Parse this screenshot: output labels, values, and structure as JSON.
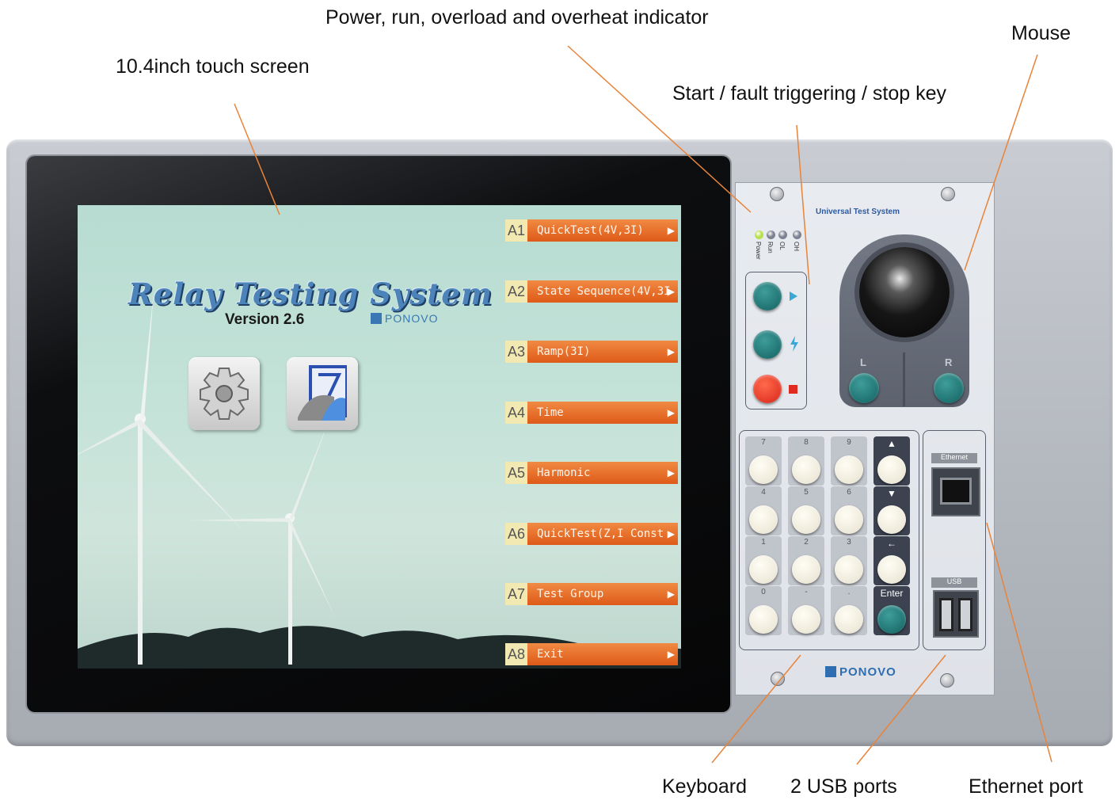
{
  "callouts": {
    "indicator": "Power, run, overload and overheat indicator",
    "mouse": "Mouse",
    "touch_screen": "10.4inch touch screen",
    "keys": "Start / fault triggering / stop key",
    "keyboard": "Keyboard",
    "usb": "2 USB ports",
    "ethernet": "Ethernet port"
  },
  "screen": {
    "title": "Relay Testing System",
    "version": "Version 2.6",
    "brand": "PONOVO",
    "icons": [
      "gear-icon",
      "document-icon"
    ],
    "menu": [
      {
        "code": "A1",
        "label": "QuickTest(4V,3I)"
      },
      {
        "code": "A2",
        "label": "State Sequence(4V,3I"
      },
      {
        "code": "A3",
        "label": "Ramp(3I)"
      },
      {
        "code": "A4",
        "label": "Time"
      },
      {
        "code": "A5",
        "label": "Harmonic"
      },
      {
        "code": "A6",
        "label": "QuickTest(Z,I Const"
      },
      {
        "code": "A7",
        "label": "Test Group"
      },
      {
        "code": "A8",
        "label": "Exit"
      }
    ]
  },
  "panel": {
    "title": "Universal Test System",
    "leds": [
      {
        "label": "Power",
        "color": "#b8e04a"
      },
      {
        "label": "Run",
        "color": "#7d8290"
      },
      {
        "label": "OL",
        "color": "#7d8290"
      },
      {
        "label": "OH",
        "color": "#7d8290"
      }
    ],
    "mouse_buttons": {
      "left": "L",
      "right": "R"
    },
    "keypad": [
      "7",
      "8",
      "9",
      "▲",
      "4",
      "5",
      "6",
      "▼",
      "1",
      "2",
      "3",
      "←",
      "0",
      "-",
      ".",
      "Enter"
    ],
    "ports": {
      "ethernet": "Ethernet",
      "usb": "USB"
    },
    "brand": "PONOVO"
  },
  "colors": {
    "menu_orange": "#e8702e",
    "key_teal": "#1f7c7a",
    "key_red": "#e83a26",
    "leader_line": "#e8833a"
  }
}
